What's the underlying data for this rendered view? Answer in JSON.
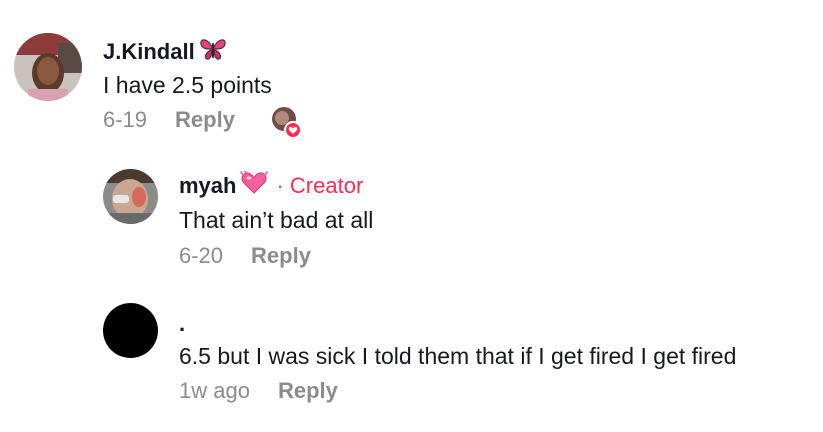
{
  "comments": [
    {
      "username": "J.Kindall",
      "username_emoji": "butterfly-icon",
      "text": "I have 2.5 points",
      "date": "6-19",
      "reply_label": "Reply",
      "creator_liked": true
    },
    {
      "username": "myah",
      "username_emoji": "heart-ribbon-icon",
      "creator_badge": "· Creator",
      "text": "That ain’t bad at all",
      "date": "6-20",
      "reply_label": "Reply"
    },
    {
      "username": ".",
      "text": "6.5 but I was sick I told them that if I get fired I get fired",
      "date": "1w ago",
      "reply_label": "Reply"
    }
  ],
  "colors": {
    "creator_accent": "#fe2c55",
    "meta_gray": "#8a8b91",
    "text_dark": "#161823"
  }
}
